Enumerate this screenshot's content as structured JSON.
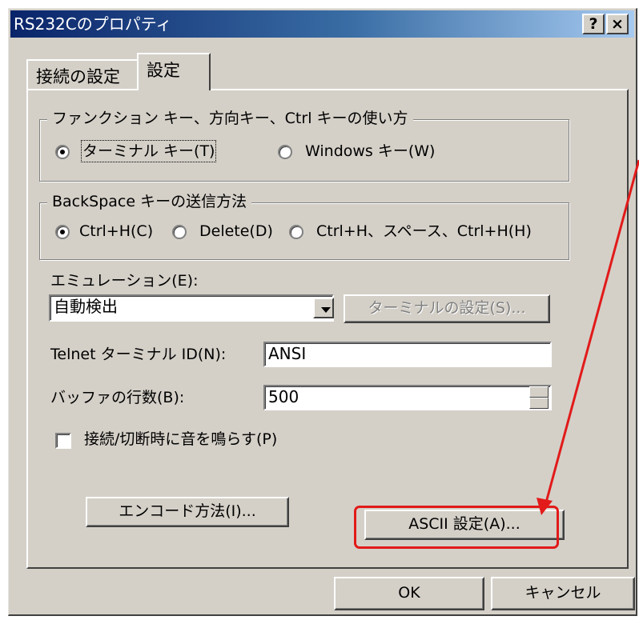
{
  "window": {
    "title": "RS232Cのプロパティ",
    "help_label": "?",
    "close_label": "×"
  },
  "tabs": [
    {
      "label": "接続の設定"
    },
    {
      "label": "設定"
    }
  ],
  "function_keys": {
    "group_label": "ファンクション キー、方向キー、Ctrl キーの使い方",
    "options": [
      {
        "label": "ターミナル キー(T)",
        "selected": true
      },
      {
        "label": "Windows キー(W)",
        "selected": false
      }
    ]
  },
  "backspace": {
    "group_label": "BackSpace キーの送信方法",
    "options": [
      {
        "label": "Ctrl+H(C)",
        "selected": true
      },
      {
        "label": "Delete(D)",
        "selected": false
      },
      {
        "label": "Ctrl+H、スペース、Ctrl+H(H)",
        "selected": false
      }
    ]
  },
  "emulation": {
    "label": "エミュレーション(E):",
    "value": "自動検出",
    "terminal_settings_label": "ターミナルの設定(S)..."
  },
  "telnet_id": {
    "label": "Telnet ターミナル ID(N):",
    "value": "ANSI"
  },
  "buffer": {
    "label": "バッファの行数(B):",
    "value": "500"
  },
  "beep": {
    "label": "接続/切断時に音を鳴らす(P)",
    "checked": false
  },
  "buttons": {
    "encoding": "エンコード方法(I)...",
    "ascii": "ASCII 設定(A)...",
    "ok": "OK",
    "cancel": "キャンセル"
  },
  "colors": {
    "annotation": "#e21a1a",
    "title_bar": "#0a246a",
    "face": "#d4d0c8"
  }
}
